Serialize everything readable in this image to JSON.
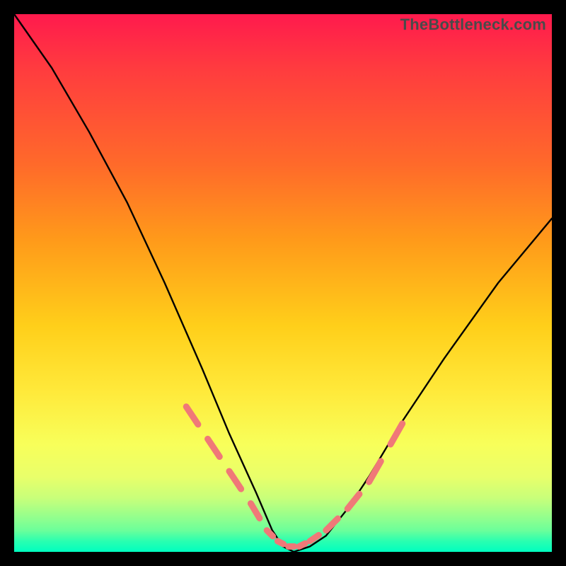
{
  "watermark": "TheBottleneck.com",
  "chart_data": {
    "type": "line",
    "title": "",
    "xlabel": "",
    "ylabel": "",
    "xlim": [
      0,
      100
    ],
    "ylim": [
      0,
      100
    ],
    "grid": false,
    "notes": "V-shaped bottleneck curve on a vertical red→yellow→green gradient background. Pink dashed overlay marks the low-bottleneck region near the valley. No axis ticks or numeric labels are visible.",
    "series": [
      {
        "name": "bottleneck-curve",
        "color": "#000000",
        "x": [
          0,
          7,
          14,
          21,
          28,
          35,
          40,
          45,
          48,
          50,
          52,
          55,
          58,
          62,
          66,
          72,
          80,
          90,
          100
        ],
        "y": [
          100,
          90,
          78,
          65,
          50,
          34,
          22,
          11,
          4,
          1,
          0,
          1,
          3,
          8,
          14,
          24,
          36,
          50,
          62
        ]
      },
      {
        "name": "good-zone-markers",
        "color": "#f07878",
        "style": "dashed",
        "x": [
          32,
          36,
          40,
          44,
          47,
          49,
          51,
          53,
          55,
          58,
          62,
          66,
          70,
          74
        ],
        "y": [
          27,
          21,
          15,
          9,
          4,
          2,
          1,
          1,
          2,
          4,
          8,
          13,
          20,
          27
        ]
      }
    ]
  }
}
